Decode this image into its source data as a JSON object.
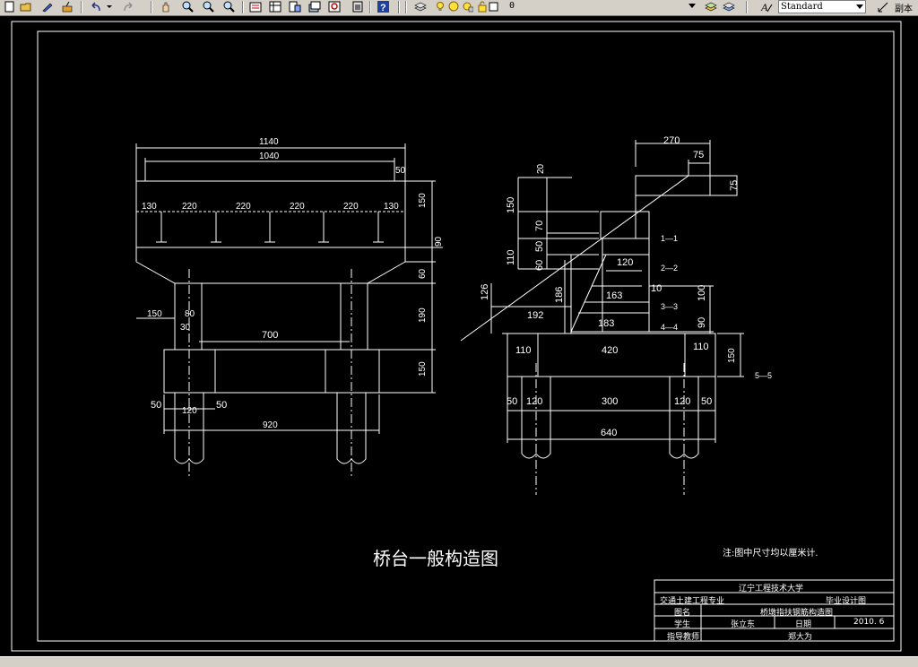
{
  "toolbar": {
    "layer_value": "0",
    "text_style_value": "Standard",
    "cut_label": "副本"
  },
  "drawing": {
    "title": "桥台一般构造图",
    "note": "注:图中尺寸均以厘米计.",
    "section_5": "5—5",
    "front_view": {
      "dims": {
        "d1140": "1140",
        "d1040": "1040",
        "d50a": "50",
        "d130a": "130",
        "d220a": "220",
        "d220b": "220",
        "d220c": "220",
        "d220d": "220",
        "d130b": "130",
        "d150a": "150",
        "d90": "90",
        "d60": "60",
        "d190": "190",
        "d150b": "150",
        "d150c": "150",
        "d80": "80",
        "d30": "30",
        "d700": "700",
        "d50b": "50",
        "d120": "120",
        "d50c": "50",
        "d920": "920"
      }
    },
    "side_view": {
      "dims": {
        "d270": "270",
        "d75a": "75",
        "d75b": "75",
        "d20": "20",
        "d150": "150",
        "d70": "70",
        "d110a": "110",
        "d50a": "50",
        "d60": "60",
        "d126": "126",
        "d186": "186",
        "d192": "192",
        "d120a": "120",
        "d163": "163",
        "d183": "183",
        "d10": "10",
        "d100": "100",
        "d90": "90",
        "s11": "1—1",
        "s22": "2—2",
        "s33": "3—3",
        "s44": "4—4",
        "d110b": "110",
        "d420": "420",
        "d110c": "110",
        "d150b": "150",
        "d50b": "50",
        "d120b": "120",
        "d300": "300",
        "d120c": "120",
        "d50c": "50",
        "d640": "640"
      }
    },
    "title_block": {
      "university": "辽宁工程技术大学",
      "major": "交通土建工程专业",
      "design_type": "毕业设计图",
      "name_label": "图名",
      "name_value": "桥墩指扶钢筋构造图",
      "student_label": "学生",
      "student_value": "张立东",
      "date_label": "日期",
      "date_value": "2010. 6",
      "advisor_label": "指导教师",
      "advisor_value": "郑大为"
    }
  }
}
